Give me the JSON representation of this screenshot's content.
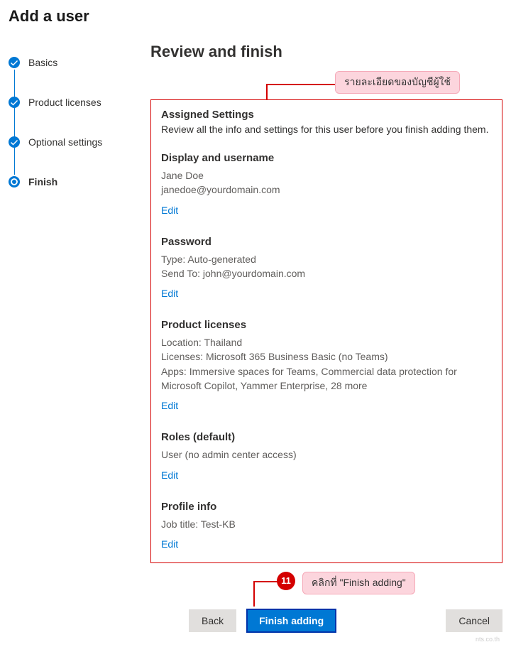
{
  "page": {
    "title": "Add a user"
  },
  "stepper": {
    "steps": [
      {
        "label": "Basics",
        "state": "done"
      },
      {
        "label": "Product licenses",
        "state": "done"
      },
      {
        "label": "Optional settings",
        "state": "done"
      },
      {
        "label": "Finish",
        "state": "current"
      }
    ]
  },
  "main": {
    "title": "Review and finish"
  },
  "annotations": {
    "top_bubble": "รายละเอียดของบัญชีผู้ใช้",
    "bottom_number": "11",
    "bottom_bubble": "คลิกที่ \"Finish adding\""
  },
  "panel": {
    "title": "Assigned Settings",
    "subtitle": "Review all the info and settings for this user before you finish adding them.",
    "edit_label": "Edit",
    "sections": {
      "display": {
        "title": "Display and username",
        "line1": "Jane Doe",
        "line2": "janedoe@yourdomain.com"
      },
      "password": {
        "title": "Password",
        "line1": "Type: Auto-generated",
        "line2": "Send To: john@yourdomain.com"
      },
      "licenses": {
        "title": "Product licenses",
        "line1": "Location: Thailand",
        "line2": "Licenses: Microsoft 365 Business Basic (no Teams)",
        "line3": "Apps: Immersive spaces for Teams, Commercial data protection for Microsoft Copilot, Yammer Enterprise, 28 more"
      },
      "roles": {
        "title": "Roles (default)",
        "line1": "User (no admin center access)"
      },
      "profile": {
        "title": "Profile info",
        "line1": "Job title: Test-KB"
      }
    }
  },
  "footer": {
    "back": "Back",
    "finish": "Finish adding",
    "cancel": "Cancel"
  },
  "watermark": "nts.co.th"
}
